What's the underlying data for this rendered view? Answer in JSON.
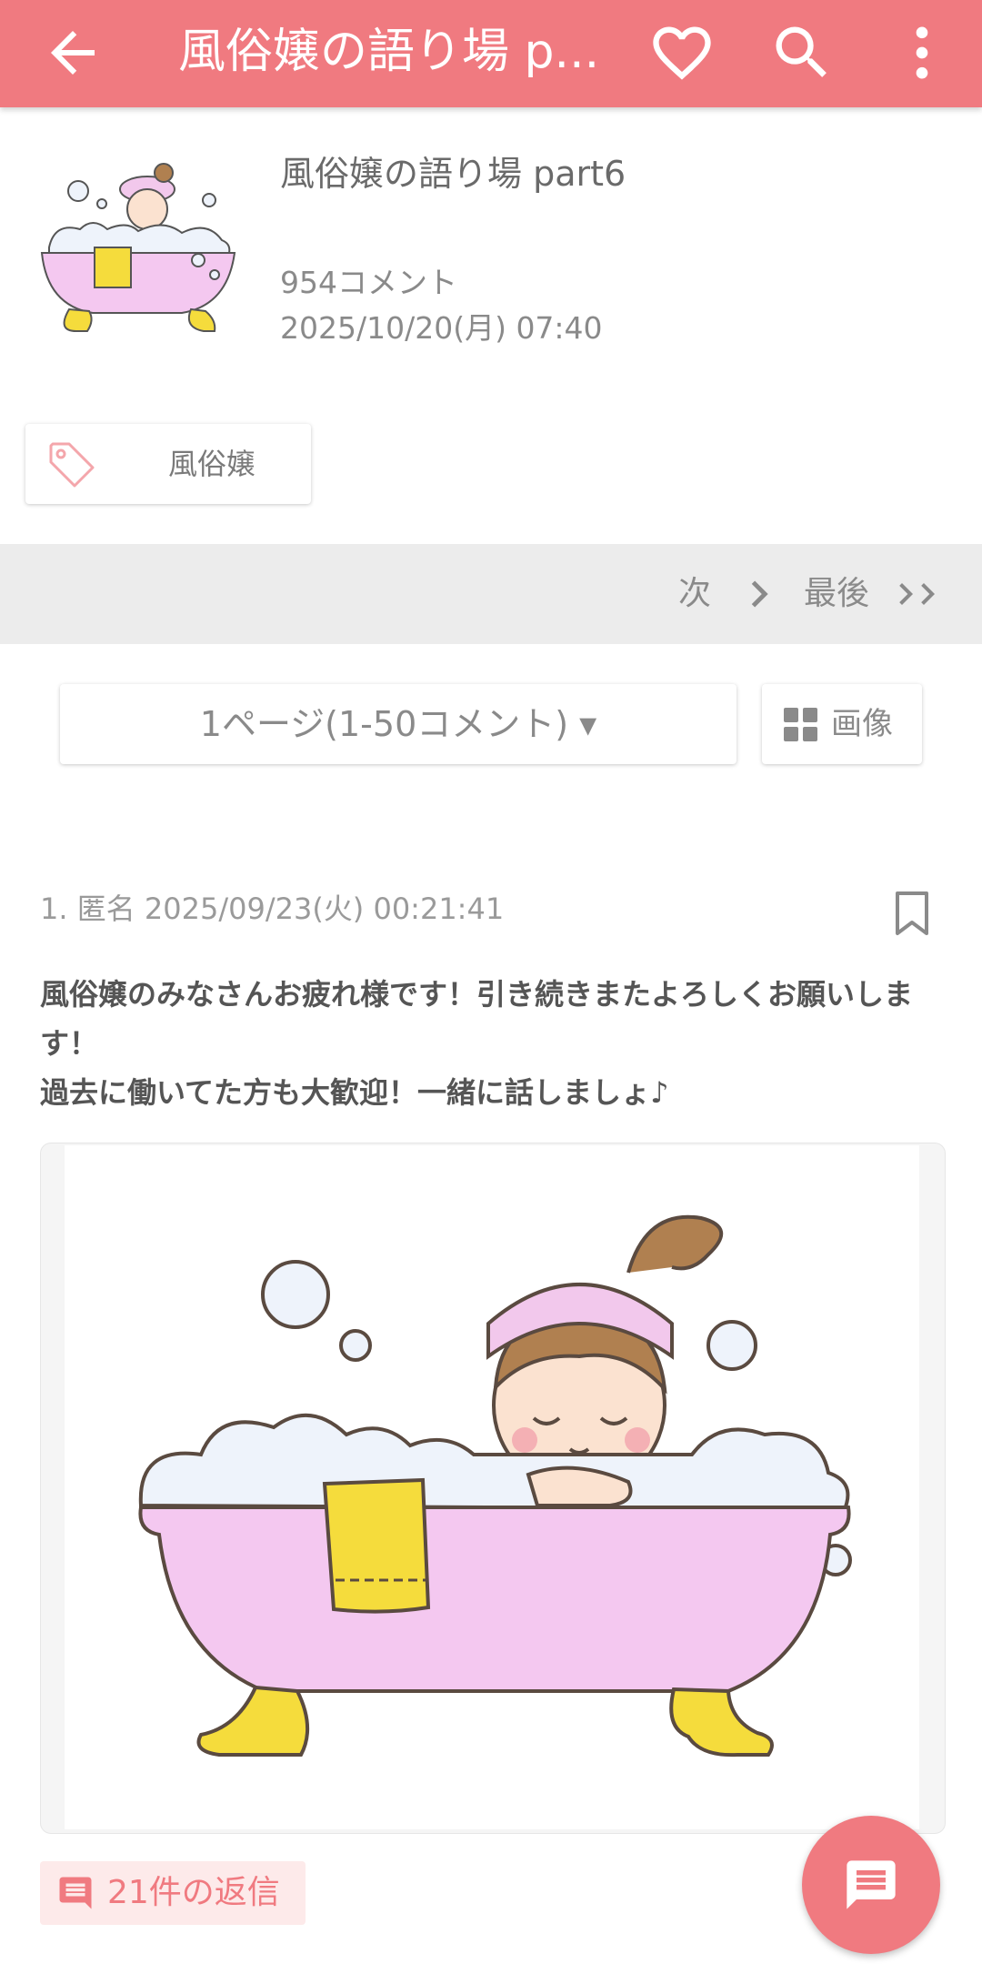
{
  "appbar": {
    "title": "風俗嬢の語り場 p...",
    "back_icon": "arrow-back-icon",
    "favorite_icon": "heart-icon",
    "search_icon": "search-icon",
    "more_icon": "more-vert-icon"
  },
  "topic": {
    "title": "風俗嬢の語り場 part6",
    "comment_count": "954コメント",
    "date": "2025/10/20(月) 07:40"
  },
  "tag": {
    "label": "風俗嬢"
  },
  "pager": {
    "next_label": "次",
    "last_label": "最後"
  },
  "page_select": {
    "label": "1ページ(1-50コメント) ▾"
  },
  "image_button": {
    "label": "画像"
  },
  "comment": {
    "meta": "1. 匿名 2025/09/23(火) 00:21:41",
    "line1": "風俗嬢のみなさんお疲れ様です！引き続きまたよろしくお願いしま",
    "line2": "す！",
    "line3": "過去に働いてた方も大歓迎！一緒に話しましょ♪"
  },
  "replies": {
    "label": "21件の返信"
  },
  "colors": {
    "accent": "#f07a80",
    "pager_bg": "#ececec",
    "reply_bg": "#fdeaea"
  }
}
